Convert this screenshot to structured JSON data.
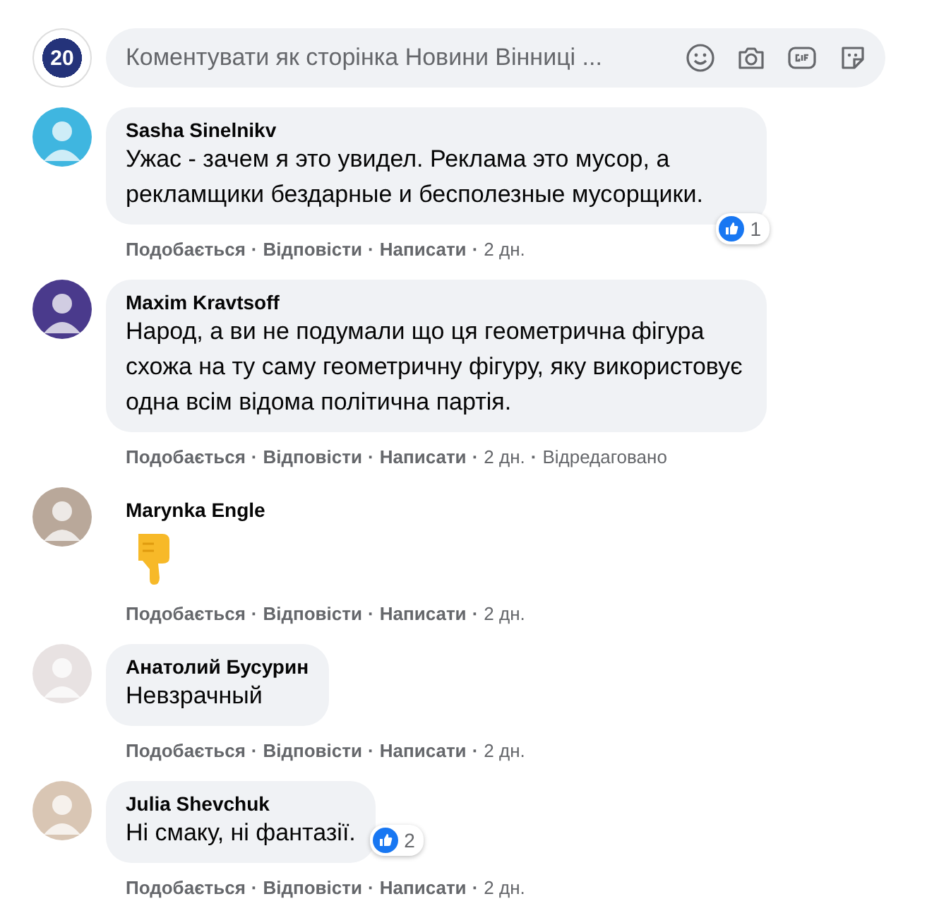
{
  "separator": "·",
  "comment_box": {
    "page_avatar_text": "20",
    "placeholder": "Коментувати як сторінка Новини Вінниці ..."
  },
  "comments": [
    {
      "kind": "text",
      "author": "Sasha Sinelnikv",
      "text": "Ужас - зачем я это увидел. Реклама это мусор, а рекламщики бездарные и бесполезные мусорщики.",
      "reactions": "1",
      "actions": [
        "Подобається",
        "Відповісти",
        "Написати"
      ],
      "time": "2 дн."
    },
    {
      "kind": "text",
      "author": "Maxim Kravtsoff",
      "text": "Народ, а ви не подумали що ця геометрична фігура схожа на ту саму геометричну фігуру, яку використовує одна всім відома політична партія.",
      "actions": [
        "Подобається",
        "Відповісти",
        "Написати"
      ],
      "time": "2 дн.",
      "edited": "Відредаговано"
    },
    {
      "kind": "emoji",
      "author": "Marynka Engle",
      "actions": [
        "Подобається",
        "Відповісти",
        "Написати"
      ],
      "time": "2 дн."
    },
    {
      "kind": "text",
      "author": "Анатолий Бусурин",
      "text": "Невзрачный",
      "actions": [
        "Подобається",
        "Відповісти",
        "Написати"
      ],
      "time": "2 дн."
    },
    {
      "kind": "text",
      "author": "Julia Shevchuk",
      "text": "Ні смаку, ні фантазії.",
      "reactions": "2",
      "actions": [
        "Подобається",
        "Відповісти",
        "Написати"
      ],
      "time": "2 дн."
    }
  ]
}
